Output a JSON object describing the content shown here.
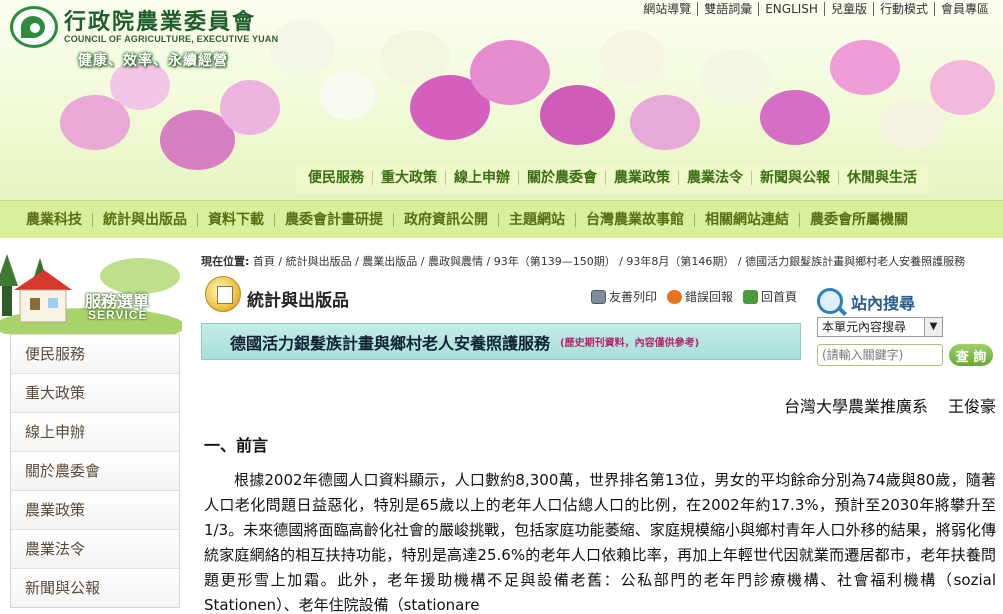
{
  "header": {
    "org_name_zh": "行政院農業委員會",
    "org_name_en": "COUNCIL OF AGRICULTURE, EXECUTIVE YUAN",
    "slogan": "健康、效率、永續經營",
    "top_links": [
      "網站導覽",
      "雙語詞彙",
      "ENGLISH",
      "兒童版",
      "行動模式",
      "會員專區"
    ]
  },
  "main_nav": [
    "便民服務",
    "重大政策",
    "線上申辦",
    "關於農委會",
    "農業政策",
    "農業法令",
    "新聞與公報",
    "休閒與生活"
  ],
  "sub_nav": [
    "農業科技",
    "統計與出版品",
    "資料下載",
    "農委會計畫研提",
    "政府資訊公開",
    "主題網站",
    "台灣農業故事館",
    "相關網站連結",
    "農委會所屬機關"
  ],
  "sidebar": {
    "service_title": "服務選單",
    "service_sub": "SERVICE",
    "items": [
      "便民服務",
      "重大政策",
      "線上申辦",
      "關於農委會",
      "農業政策",
      "農業法令",
      "新聞與公報"
    ]
  },
  "breadcrumb": {
    "label": "現在位置:",
    "path": "首頁 / 統計與出版品 / 農業出版品 / 農政與農情 / 93年（第139—150期） / 93年8月（第146期） / 德國活力銀髮族計畫與鄉村老人安養照護服務"
  },
  "section": {
    "title": "統計與出版品",
    "tools": {
      "print": "友善列印",
      "error": "錯誤回報",
      "home": "回首頁"
    }
  },
  "article": {
    "title": "德國活力銀髮族計畫與鄉村老人安養照護服務",
    "note": "(歷史期刊資料，內容僅供參考)",
    "author_affiliation": "台灣大學農業推廣系",
    "author_name": "王俊豪",
    "heading": "一、前言",
    "paragraph": "根據2002年德國人口資料顯示，人口數約8,300萬，世界排名第13位，男女的平均餘命分別為74歲與80歲，隨著人口老化問題日益惡化，特別是65歲以上的老年人口佔總人口的比例，在2002年約17.3%，預計至2030年將攀升至1/3。未來德國將面臨高齡化社會的嚴峻挑戰，包括家庭功能萎縮、家庭規模縮小與鄉村青年人口外移的結果，將弱化傳統家庭網絡的相互扶持功能，特別是高達25.6%的老年人口依賴比率，再加上年輕世代因就業而遷居都市，老年扶養問題更形雪上加霜。此外，老年援助機構不足與設備老舊：公私部門的老年門診療機構、社會福利機構（sozial Stationen）、老年住院設備（stationare"
  },
  "search": {
    "title": "站內搜尋",
    "scope": "本單元內容搜尋",
    "placeholder": "(請輸入關鍵字)",
    "button": "查 詢"
  }
}
